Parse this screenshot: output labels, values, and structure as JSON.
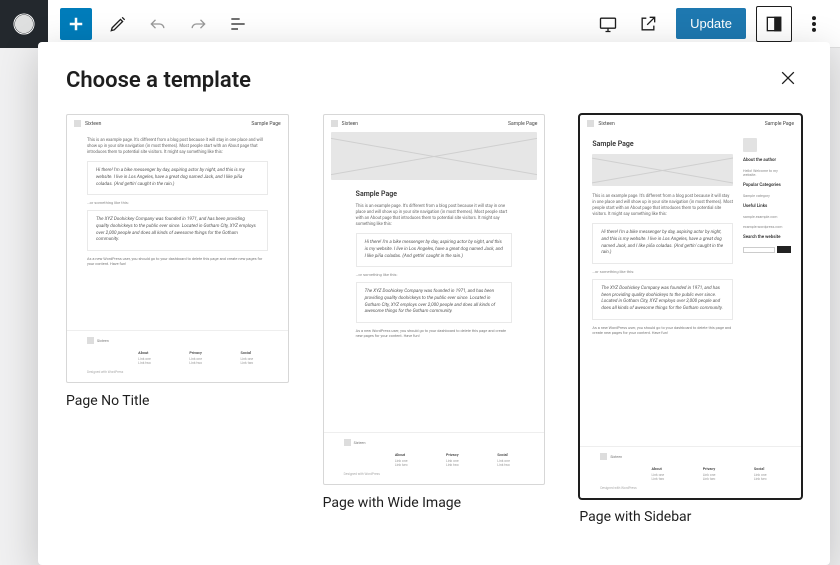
{
  "toolbar": {
    "insert_label": "Toggle block inserter",
    "update_label": "Update"
  },
  "modal": {
    "title": "Choose a template",
    "close_label": "Close"
  },
  "templates": [
    {
      "label": "Page No Title",
      "selected": false
    },
    {
      "label": "Page with Wide Image",
      "selected": false
    },
    {
      "label": "Page with Sidebar",
      "selected": true
    }
  ],
  "preview": {
    "brand": "Sixteen",
    "header_link": "Sample Page",
    "page_title": "Sample Page",
    "intro": "This is an example page. It's different from a blog post because it will stay in one place and will show up in your site navigation (in most themes). Most people start with an About page that introduces them to potential site visitors. It might say something like this:",
    "quote1": "Hi there! I'm a bike messenger by day, aspiring actor by night, and this is my website. I live in Los Angeles, have a great dog named Jack, and I like piña coladas. (And gettin' caught in the rain.)",
    "bridge": "…or something like this:",
    "quote2": "The XYZ Doohickey Company was founded in 1971, and has been providing quality doohickeys to the public ever since. Located in Gotham City, XYZ employs over 2,000 people and does all kinds of awesome things for the Gotham community.",
    "outro": "As a new WordPress user, you should go to your dashboard to delete this page and create new pages for your content. Have fun!",
    "sidebar": {
      "about_title": "About the author",
      "about_text": "Hello! Welcome to my website.",
      "categories_title": "Popular Categories",
      "category": "Sample category",
      "links_title": "Useful Links",
      "link1": "sample.example.com",
      "link2": "example.wordpress.com",
      "search_title": "Search the website",
      "search_button": "Search"
    },
    "footer": {
      "col1_title": "About",
      "col2_title": "Privacy",
      "col3_title": "Social",
      "line1": "Link one",
      "line2": "Link two",
      "brand": "Sixteen",
      "credit": "Designed with WordPress"
    }
  }
}
